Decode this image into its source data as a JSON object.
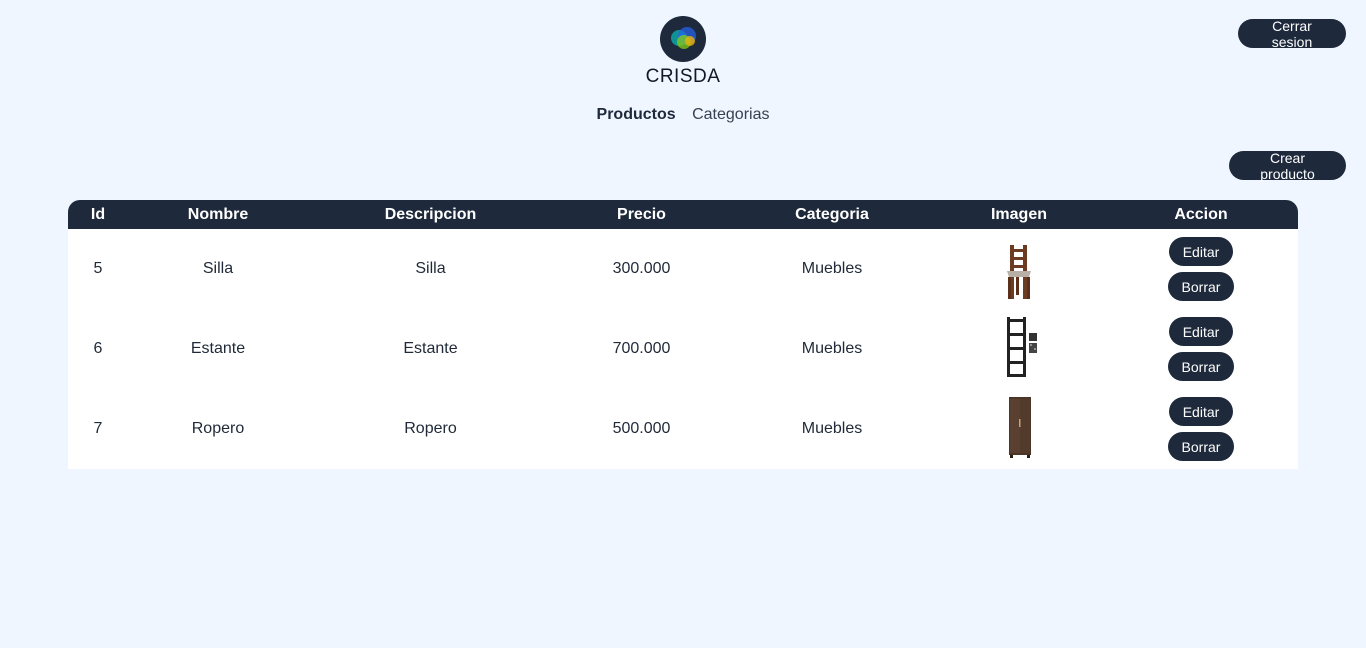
{
  "brand": {
    "name": "CRISDA"
  },
  "header": {
    "logout_label": "Cerrar sesion"
  },
  "nav": [
    {
      "label": "Productos",
      "active": true
    },
    {
      "label": "Categorias",
      "active": false
    }
  ],
  "toolbar": {
    "create_label": "Crear producto"
  },
  "table": {
    "columns": [
      "Id",
      "Nombre",
      "Descripcion",
      "Precio",
      "Categoria",
      "Imagen",
      "Accion"
    ],
    "rows": [
      {
        "id": "5",
        "nombre": "Silla",
        "descripcion": "Silla",
        "precio": "300.000",
        "categoria": "Muebles",
        "image_icon": "chair-icon"
      },
      {
        "id": "6",
        "nombre": "Estante",
        "descripcion": "Estante",
        "precio": "700.000",
        "categoria": "Muebles",
        "image_icon": "shelf-icon"
      },
      {
        "id": "7",
        "nombre": "Ropero",
        "descripcion": "Ropero",
        "precio": "500.000",
        "categoria": "Muebles",
        "image_icon": "wardrobe-icon"
      }
    ],
    "edit_label": "Editar",
    "delete_label": "Borrar"
  },
  "colors": {
    "background": "#eff6ff",
    "primary": "#1e293b",
    "row_bg": "#ffffff"
  }
}
